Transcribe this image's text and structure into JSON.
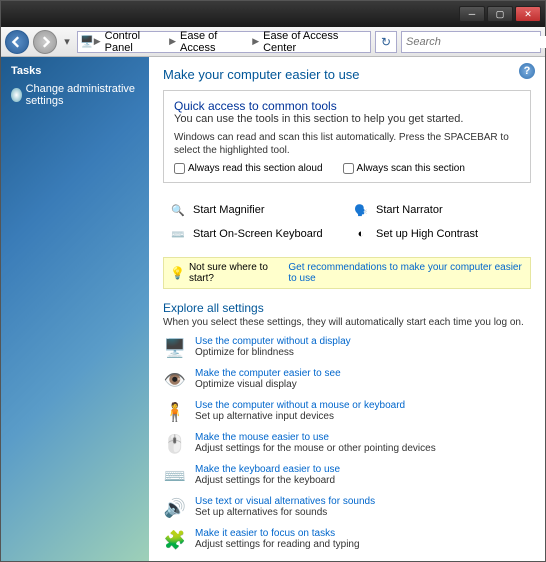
{
  "breadcrumb": {
    "item1": "Control Panel",
    "item2": "Ease of Access",
    "item3": "Ease of Access Center"
  },
  "search": {
    "placeholder": "Search"
  },
  "sidebar": {
    "tasks": "Tasks",
    "link1": "Change administrative settings"
  },
  "main": {
    "title": "Make your computer easier to use",
    "box": {
      "heading": "Quick access to common tools",
      "sub": "You can use the tools in this section to help you get started.",
      "note": "Windows can read and scan this list automatically.  Press the SPACEBAR to select the highlighted tool.",
      "chk1": "Always read this section aloud",
      "chk2": "Always scan this section"
    },
    "tools": {
      "t1": "Start Magnifier",
      "t2": "Start Narrator",
      "t3": "Start On-Screen Keyboard",
      "t4": "Set up High Contrast"
    },
    "hint": {
      "text": "Not sure where to start?",
      "link": "Get recommendations to make your computer easier to use"
    },
    "explore": {
      "heading": "Explore all settings",
      "sub": "When you select these settings, they will automatically start each time you log on."
    },
    "settings": [
      {
        "link": "Use the computer without a display",
        "desc": "Optimize for blindness"
      },
      {
        "link": "Make the computer easier to see",
        "desc": "Optimize visual display"
      },
      {
        "link": "Use the computer without a mouse or keyboard",
        "desc": "Set up alternative input devices"
      },
      {
        "link": "Make the mouse easier to use",
        "desc": "Adjust settings for the mouse or other pointing devices"
      },
      {
        "link": "Make the keyboard easier to use",
        "desc": "Adjust settings for the keyboard"
      },
      {
        "link": "Use text or visual alternatives for sounds",
        "desc": "Set up alternatives for sounds"
      },
      {
        "link": "Make it easier to focus on tasks",
        "desc": "Adjust settings for reading and typing"
      }
    ]
  }
}
